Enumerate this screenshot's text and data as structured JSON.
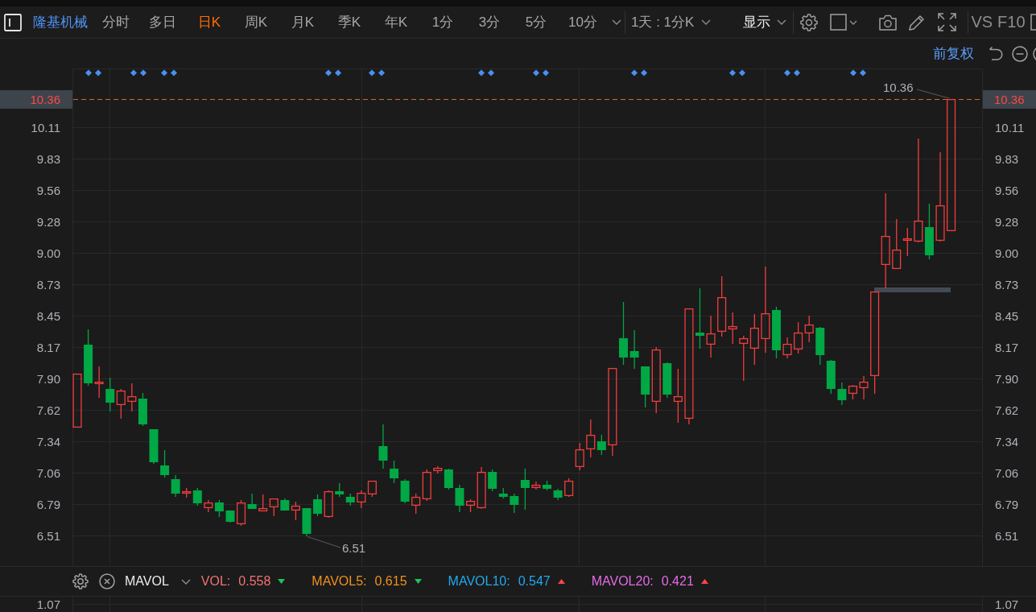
{
  "toolbar": {
    "stock_name": "隆基机械",
    "periods": [
      {
        "label": "分时",
        "selected": false
      },
      {
        "label": "多日",
        "selected": false
      },
      {
        "label": "日K",
        "selected": true
      },
      {
        "label": "周K",
        "selected": false
      },
      {
        "label": "月K",
        "selected": false
      },
      {
        "label": "季K",
        "selected": false
      },
      {
        "label": "年K",
        "selected": false
      },
      {
        "label": "1分",
        "selected": false
      },
      {
        "label": "3分",
        "selected": false
      },
      {
        "label": "5分",
        "selected": false
      },
      {
        "label": "10分",
        "selected": false
      }
    ],
    "range": "1天 : 1分K",
    "display": "显示",
    "buttons": [
      "VS",
      "F10"
    ]
  },
  "chart": {
    "adjustment": "前复权",
    "left_axis": {
      "price_tag": "10.36",
      "ticks": [
        "10.11",
        "9.83",
        "9.56",
        "9.28",
        "9.00",
        "8.73",
        "8.45",
        "8.17",
        "7.90",
        "7.62",
        "7.34",
        "7.06",
        "6.79",
        "6.51"
      ]
    },
    "right_axis": {
      "price_tag": "10.36",
      "ticks": [
        "10.11",
        "9.83",
        "9.56",
        "9.28",
        "9.00",
        "8.73",
        "8.45",
        "8.17",
        "7.90",
        "7.62",
        "7.34",
        "7.06",
        "6.79",
        "6.51"
      ]
    },
    "high_label": "10.36",
    "low_label": "6.51"
  },
  "indicator": {
    "name": "MAVOL",
    "values": [
      {
        "label": "VOL:",
        "value": "0.558",
        "rising": false,
        "color": "#f27272"
      },
      {
        "label": "MAVOL5:",
        "value": "0.615",
        "rising": false,
        "color": "#f0911e"
      },
      {
        "label": "MAVOL10:",
        "value": "0.547",
        "rising": true,
        "color": "#22a9ee"
      },
      {
        "label": "MAVOL20:",
        "value": "0.421",
        "rising": true,
        "color": "#e46be6"
      }
    ]
  },
  "volume_pane": {
    "left_axis": [
      "1.07"
    ],
    "right_axis": [
      "1.07"
    ]
  }
}
